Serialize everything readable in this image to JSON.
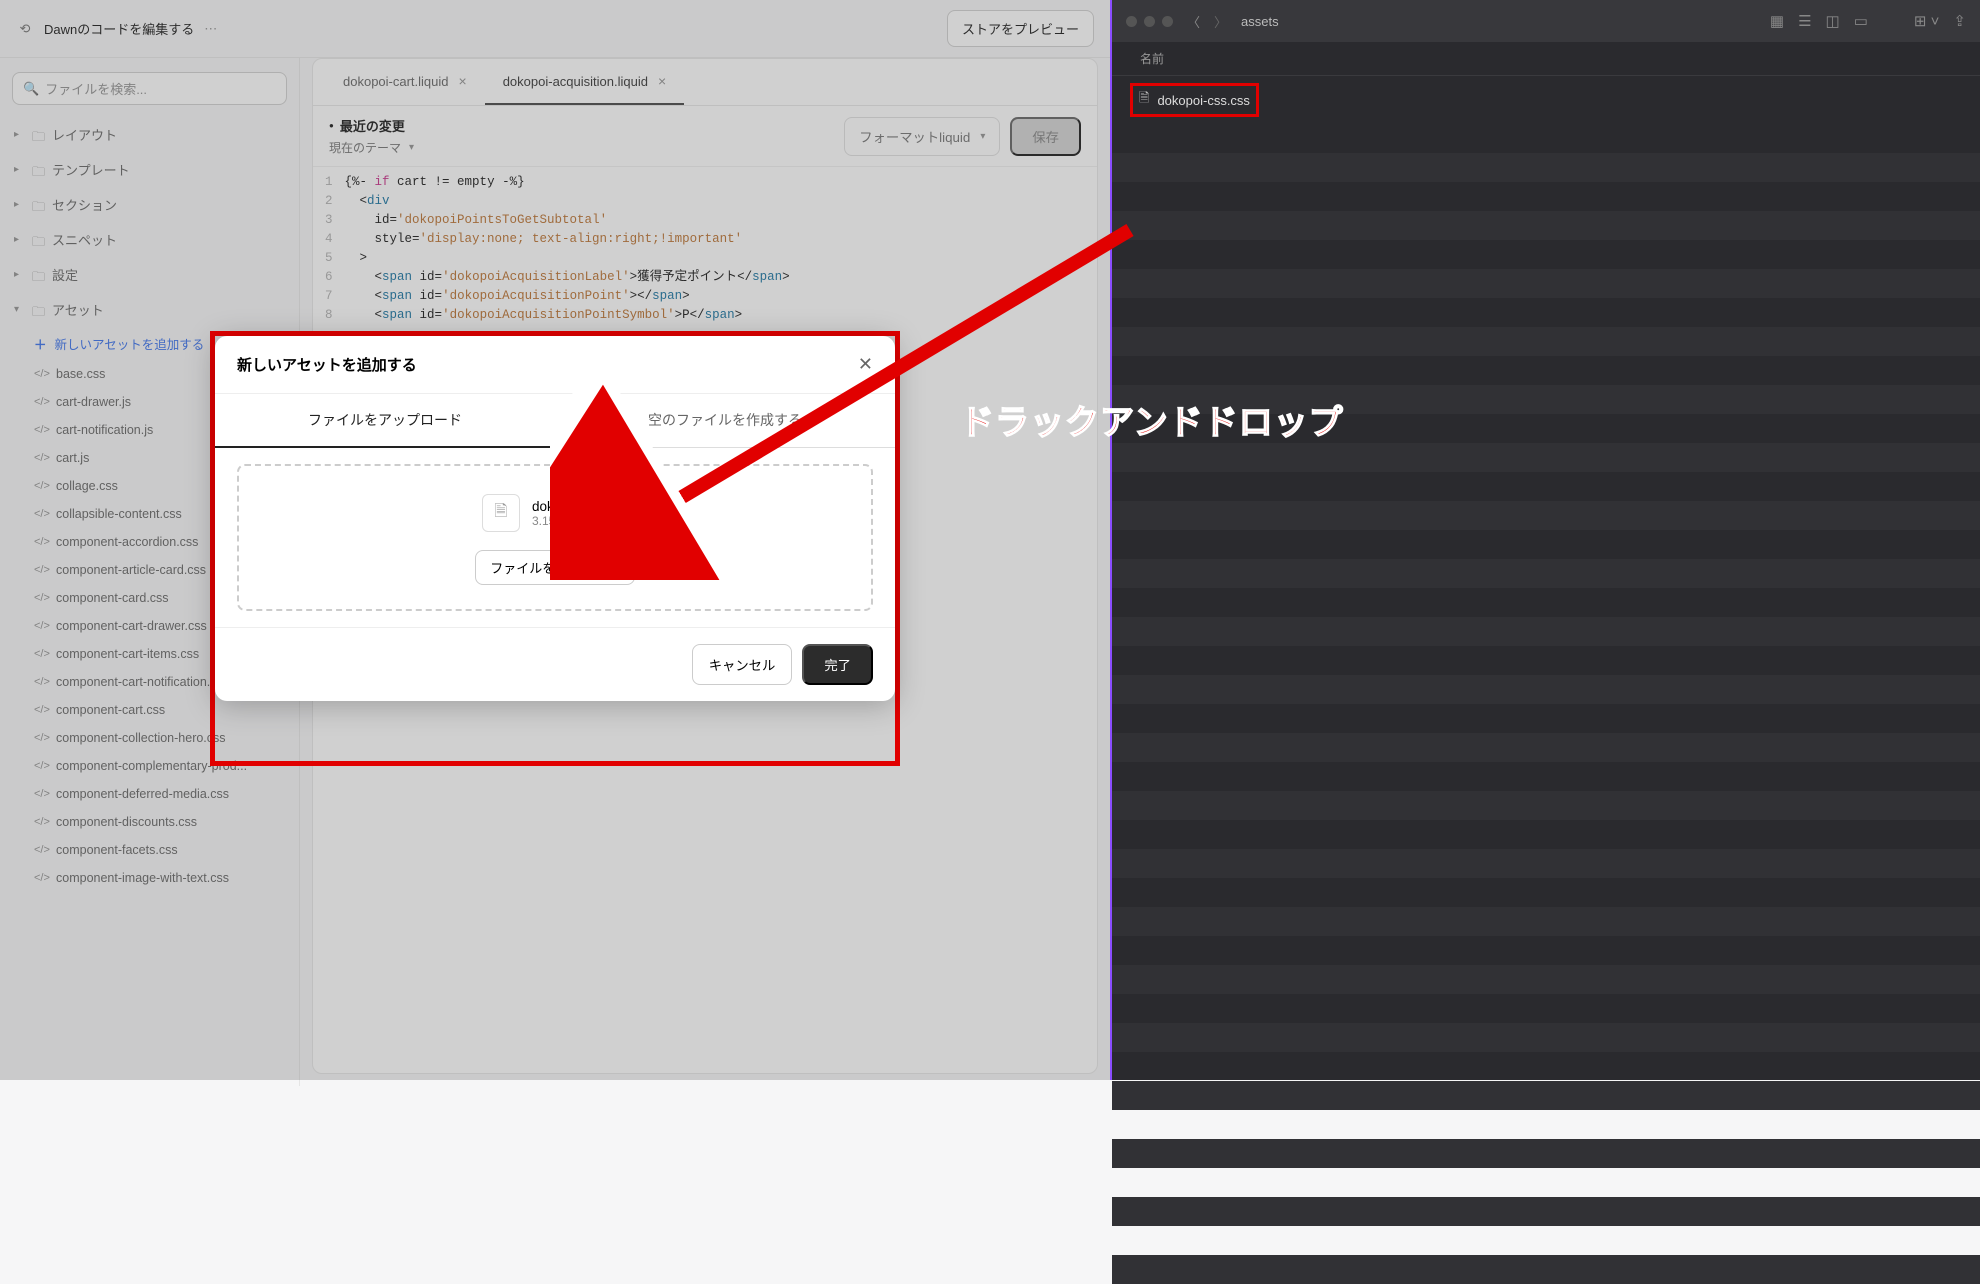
{
  "header": {
    "title": "Dawnのコードを編集する",
    "preview_btn": "ストアをプレビュー"
  },
  "search": {
    "placeholder": "ファイルを検索..."
  },
  "tree": {
    "sections": [
      "レイアウト",
      "テンプレート",
      "セクション",
      "スニペット",
      "設定",
      "アセット"
    ],
    "add_asset": "新しいアセットを追加する",
    "assets": [
      "base.css",
      "cart-drawer.js",
      "cart-notification.js",
      "cart.js",
      "collage.css",
      "collapsible-content.css",
      "component-accordion.css",
      "component-article-card.css",
      "component-card.css",
      "component-cart-drawer.css",
      "component-cart-items.css",
      "component-cart-notification.css",
      "component-cart.css",
      "component-collection-hero.css",
      "component-complementary-prod...",
      "component-deferred-media.css",
      "component-discounts.css",
      "component-facets.css",
      "component-image-with-text.css"
    ]
  },
  "tabs": [
    {
      "label": "dokopoi-cart.liquid",
      "active": false
    },
    {
      "label": "dokopoi-acquisition.liquid",
      "active": true
    }
  ],
  "editor_sub": {
    "recent": "最近の変更",
    "theme": "現在のテーマ",
    "format": "フォーマットliquid",
    "save": "保存"
  },
  "code": {
    "lines": [
      {
        "n": 1,
        "html": "{%- <span class='kw'>if</span> cart != empty -%}"
      },
      {
        "n": 2,
        "html": "  &lt;<span class='tag'>div</span>"
      },
      {
        "n": 3,
        "html": "    id=<span class='str'>'dokopoiPointsToGetSubtotal'</span>"
      },
      {
        "n": 4,
        "html": "    style=<span class='str'>'display:none; text-align:right;!important'</span>"
      },
      {
        "n": 5,
        "html": "  &gt;"
      },
      {
        "n": 6,
        "html": "    &lt;<span class='tag'>span</span> id=<span class='str'>'dokopoiAcquisitionLabel'</span>&gt;獲得予定ポイント&lt;/<span class='tag'>span</span>&gt;"
      },
      {
        "n": 7,
        "html": "    &lt;<span class='tag'>span</span> id=<span class='str'>'dokopoiAcquisitionPoint'</span>&gt;&lt;/<span class='tag'>span</span>&gt;"
      },
      {
        "n": 8,
        "html": "    &lt;<span class='tag'>span</span> id=<span class='str'>'dokopoiAcquisitionPointSymbol'</span>&gt;P&lt;/<span class='tag'>span</span>&gt;"
      }
    ]
  },
  "modal": {
    "title": "新しいアセットを追加する",
    "tab_upload": "ファイルをアップロード",
    "tab_blank": "空のファイルを作成する",
    "file_name": "dokopoi-css.css",
    "file_size": "3.15KB",
    "replace": "ファイルを置き換える",
    "cancel": "キャンセル",
    "done": "完了"
  },
  "finder": {
    "path": "assets",
    "col_name": "名前",
    "file": "dokopoi-css.css"
  },
  "annotation": {
    "text": "ドラックアンドドロップ"
  }
}
